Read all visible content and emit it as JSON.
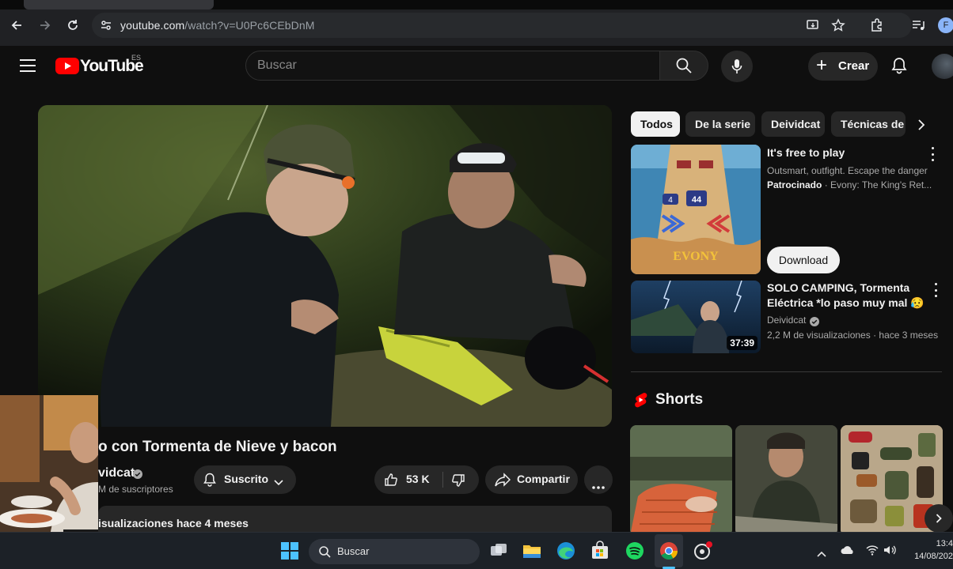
{
  "browser": {
    "url_host": "youtube.com",
    "url_path": "/watch?v=U0Pc6CEbDnM",
    "profile_initial": "F"
  },
  "header": {
    "logo_text": "YouTube",
    "region": "ES",
    "search_placeholder": "Buscar",
    "create_label": "Crear"
  },
  "video": {
    "title": "o con Tormenta de Nieve y bacon",
    "channel": "vidcat",
    "subscribers": "M de suscriptores",
    "subscribed_label": "Suscrito",
    "likes": "53 K",
    "share_label": "Compartir",
    "views_time": "isualizaciones  hace 4 meses"
  },
  "sidebar": {
    "chips": [
      "Todos",
      "De la serie",
      "Deividcat",
      "Técnicas de"
    ],
    "ad": {
      "title": "It's free to play",
      "desc": "Outsmart, outfight. Escape the danger",
      "sponsored": "Patrocinado",
      "advertiser": " · Evony: The King's Ret...",
      "button": "Download",
      "thumb_numbers": [
        "44",
        "4"
      ],
      "thumb_logo": "EVONY"
    },
    "rec": {
      "title": "SOLO CAMPING, Tormenta Eléctrica *lo paso muy mal",
      "emoji": "😥",
      "channel": "Deividcat",
      "meta": "2,2 M de visualizaciones · hace 3 meses",
      "duration": "37:39"
    },
    "shorts_title": "Shorts"
  },
  "taskbar": {
    "search_label": "Buscar",
    "time": "13:4",
    "date": "14/08/202"
  },
  "colors": {
    "yt_red": "#ff0000",
    "bg": "#0f0f0f",
    "chip_bg": "#272727"
  }
}
